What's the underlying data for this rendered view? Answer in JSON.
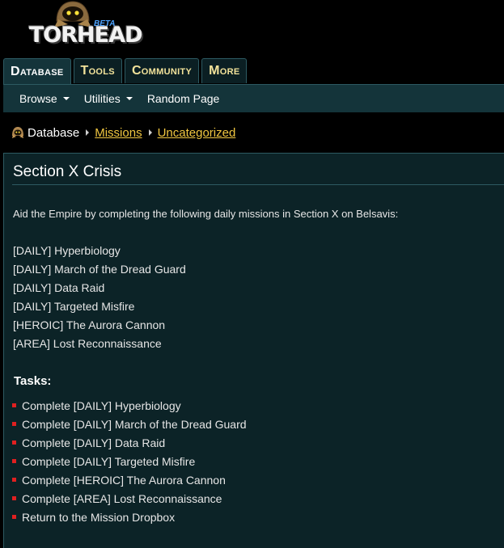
{
  "site": {
    "logo_text": "TORHEAD",
    "logo_badge": "BETA"
  },
  "tabs": [
    {
      "label": "Database",
      "active": true
    },
    {
      "label": "Tools",
      "active": false
    },
    {
      "label": "Community",
      "active": false
    },
    {
      "label": "More",
      "active": false
    }
  ],
  "subnav": {
    "browse": "Browse",
    "utilities": "Utilities",
    "random_page": "Random Page"
  },
  "breadcrumb": {
    "root": "Database",
    "items": [
      "Missions",
      "Uncategorized"
    ]
  },
  "page": {
    "title": "Section X Crisis",
    "intro": "Aid the Empire by completing the following daily missions in Section X on Belsavis:",
    "missions": [
      "[DAILY] Hyperbiology",
      "[DAILY] March of the Dread Guard",
      "[DAILY] Data Raid",
      "[DAILY] Targeted Misfire",
      "[HEROIC] The Aurora Cannon",
      "[AREA] Lost Reconnaissance"
    ],
    "tasks_heading": "Tasks:",
    "tasks": [
      "Complete [DAILY] Hyperbiology",
      "Complete [DAILY] March of the Dread Guard",
      "Complete [DAILY] Data Raid",
      "Complete [DAILY] Targeted Misfire",
      "Complete [HEROIC] The Aurora Cannon",
      "Complete [AREA] Lost Reconnaissance",
      "Return to the Mission Dropbox"
    ]
  },
  "colors": {
    "background": "#000000",
    "panel": "#0c2327",
    "tab_text": "#f2e29a",
    "link": "#f0c640",
    "bullet": "#e02020",
    "logo_badge": "#4da3ff"
  },
  "icons": {
    "breadcrumb_root": "hooded-mascot-icon",
    "dropdown": "caret-down-icon",
    "separator": "caret-right-icon"
  }
}
